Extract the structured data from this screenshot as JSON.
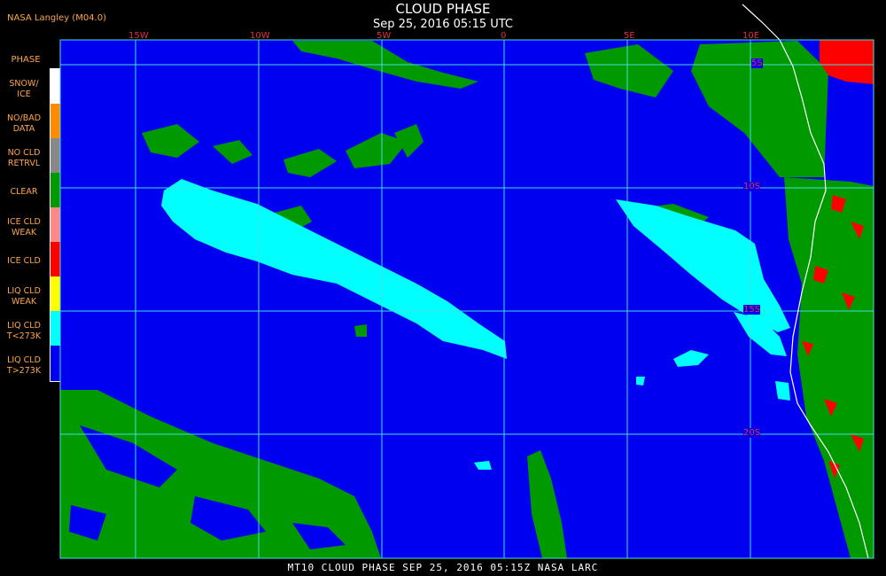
{
  "header": {
    "title": "CLOUD PHASE",
    "subtitle": "Sep 25, 2016 05:15 UTC",
    "producer": "NASA Langley (M04.0)"
  },
  "legend": {
    "title": "PHASE",
    "items": [
      {
        "line1": "SNOW/",
        "line2": "ICE",
        "color": "#ffffff"
      },
      {
        "line1": "NO/BAD",
        "line2": "DATA",
        "color": "#ff8c00"
      },
      {
        "line1": "NO CLD",
        "line2": "RETRVL",
        "color": "#888888"
      },
      {
        "line1": "CLEAR",
        "line2": "",
        "color": "#009900"
      },
      {
        "line1": "ICE CLD",
        "line2": "WEAK",
        "color": "#ff8888"
      },
      {
        "line1": "ICE CLD",
        "line2": "",
        "color": "#ff0000"
      },
      {
        "line1": "LIQ CLD",
        "line2": "WEAK",
        "color": "#ffff00"
      },
      {
        "line1": "LIQ CLD",
        "line2": "T<273K",
        "color": "#00ffff"
      },
      {
        "line1": "LIQ CLD",
        "line2": "T>273K",
        "color": "#0000f0"
      }
    ]
  },
  "map": {
    "lon_labels": [
      "15W",
      "10W",
      "5W",
      "0",
      "5E",
      "10E"
    ],
    "lat_labels": [
      "5S",
      "10S",
      "15S",
      "20S"
    ],
    "colors": {
      "ocean": "#0000f0",
      "grid": "#40e0e0",
      "coast": "#ffffff"
    }
  },
  "footer": "MT10   CLOUD PHASE   SEP 25, 2016 05:15Z   NASA LARC"
}
